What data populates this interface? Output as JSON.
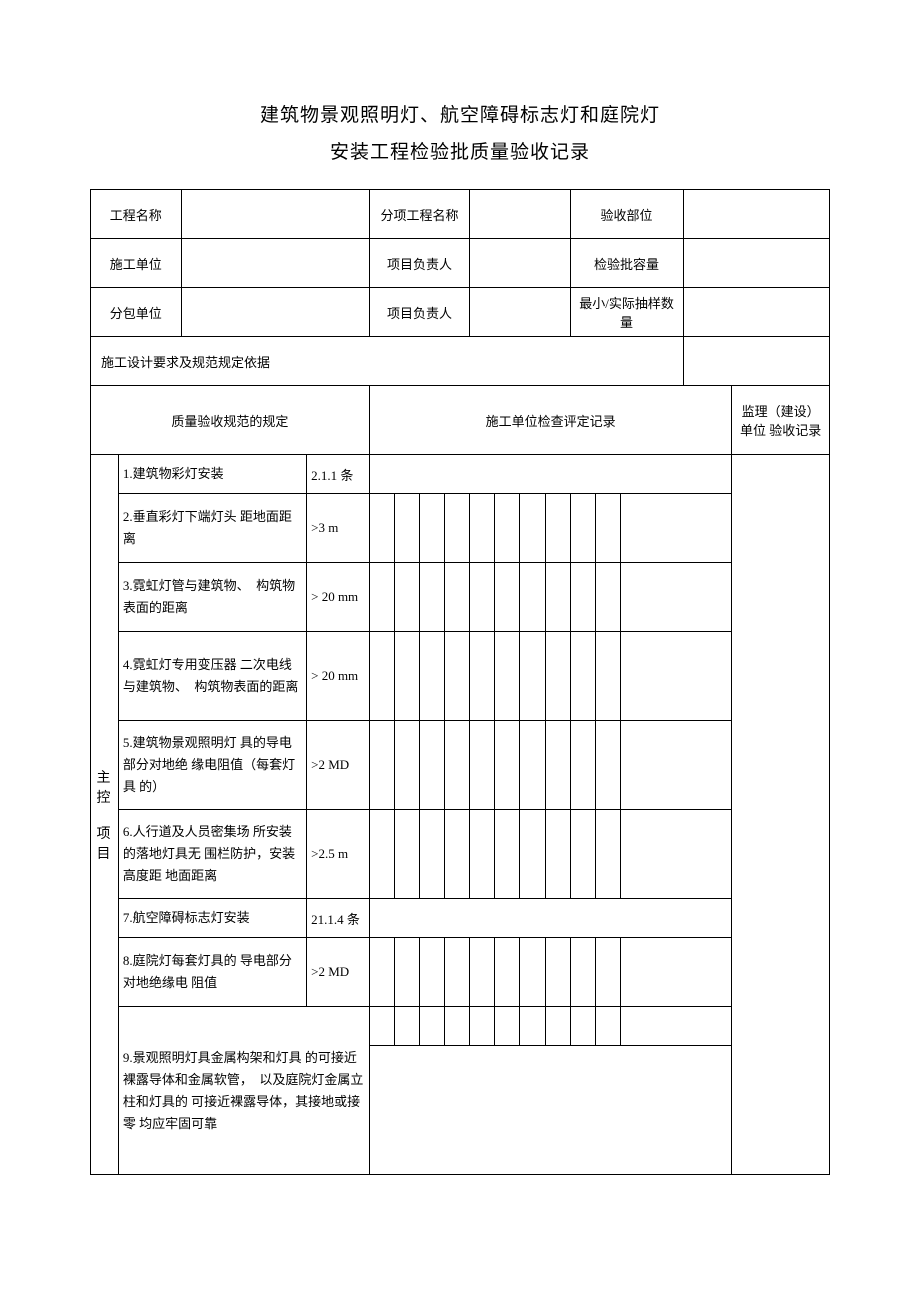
{
  "title": "建筑物景观照明灯、航空障碍标志灯和庭院灯",
  "subtitle": "安装工程检验批质量验收记录",
  "header": {
    "project_name_label": "工程名称",
    "project_name": "",
    "subitem_label": "分项工程名称",
    "subitem": "",
    "accept_part_label": "验收部位",
    "accept_part": "",
    "construct_unit_label": "施工单位",
    "construct_unit": "",
    "pm_label": "项目负责人",
    "pm": "",
    "batch_capacity_label": "检验批容量",
    "batch_capacity": "",
    "sub_unit_label": "分包单位",
    "sub_unit": "",
    "pm2_label": "项目负责人",
    "pm2": "",
    "min_actual_label": "最小/实际抽样数量",
    "min_actual": ""
  },
  "basis_label": "施工设计要求及规范规定依据",
  "columns": {
    "spec_label": "质量验收规范的规定",
    "record_label": "施工单位检查评定记录",
    "supervise_label": "监理（建设）单位 验收记录"
  },
  "section_label": "主 控\n\n项 目",
  "items": [
    {
      "desc": "1.建筑物彩灯安装",
      "std": "2.1.1 条"
    },
    {
      "desc": "2.垂直彩灯下端灯头 距地面距离",
      "std": ">3 m"
    },
    {
      "desc": "3.霓虹灯管与建筑物、　构筑物表面的距离",
      "std": "> 20 mm"
    },
    {
      "desc": "4.霓虹灯专用变压器 二次电线与建筑物、　构筑物表面的距离",
      "std": "> 20 mm"
    },
    {
      "desc": "5.建筑物景观照明灯 具的导电部分对地绝 缘电阻值（每套灯具 的）",
      "std": ">2 MD"
    },
    {
      "desc": "6.人行道及人员密集场 所安装的落地灯具无 围栏防护，安装高度距 地面距离",
      "std": ">2.5 m"
    },
    {
      "desc": "7.航空障碍标志灯安装",
      "std": "21.1.4 条"
    },
    {
      "desc": "8.庭院灯每套灯具的 导电部分对地绝缘电 阻值",
      "std": ">2 MD"
    },
    {
      "desc": "9.景观照明灯具金属构架和灯具 的可接近裸露导体和金属软管，　以及庭院灯金属立柱和灯具的 可接近裸露导体，其接地或接零 均应牢固可靠",
      "std": ""
    }
  ]
}
